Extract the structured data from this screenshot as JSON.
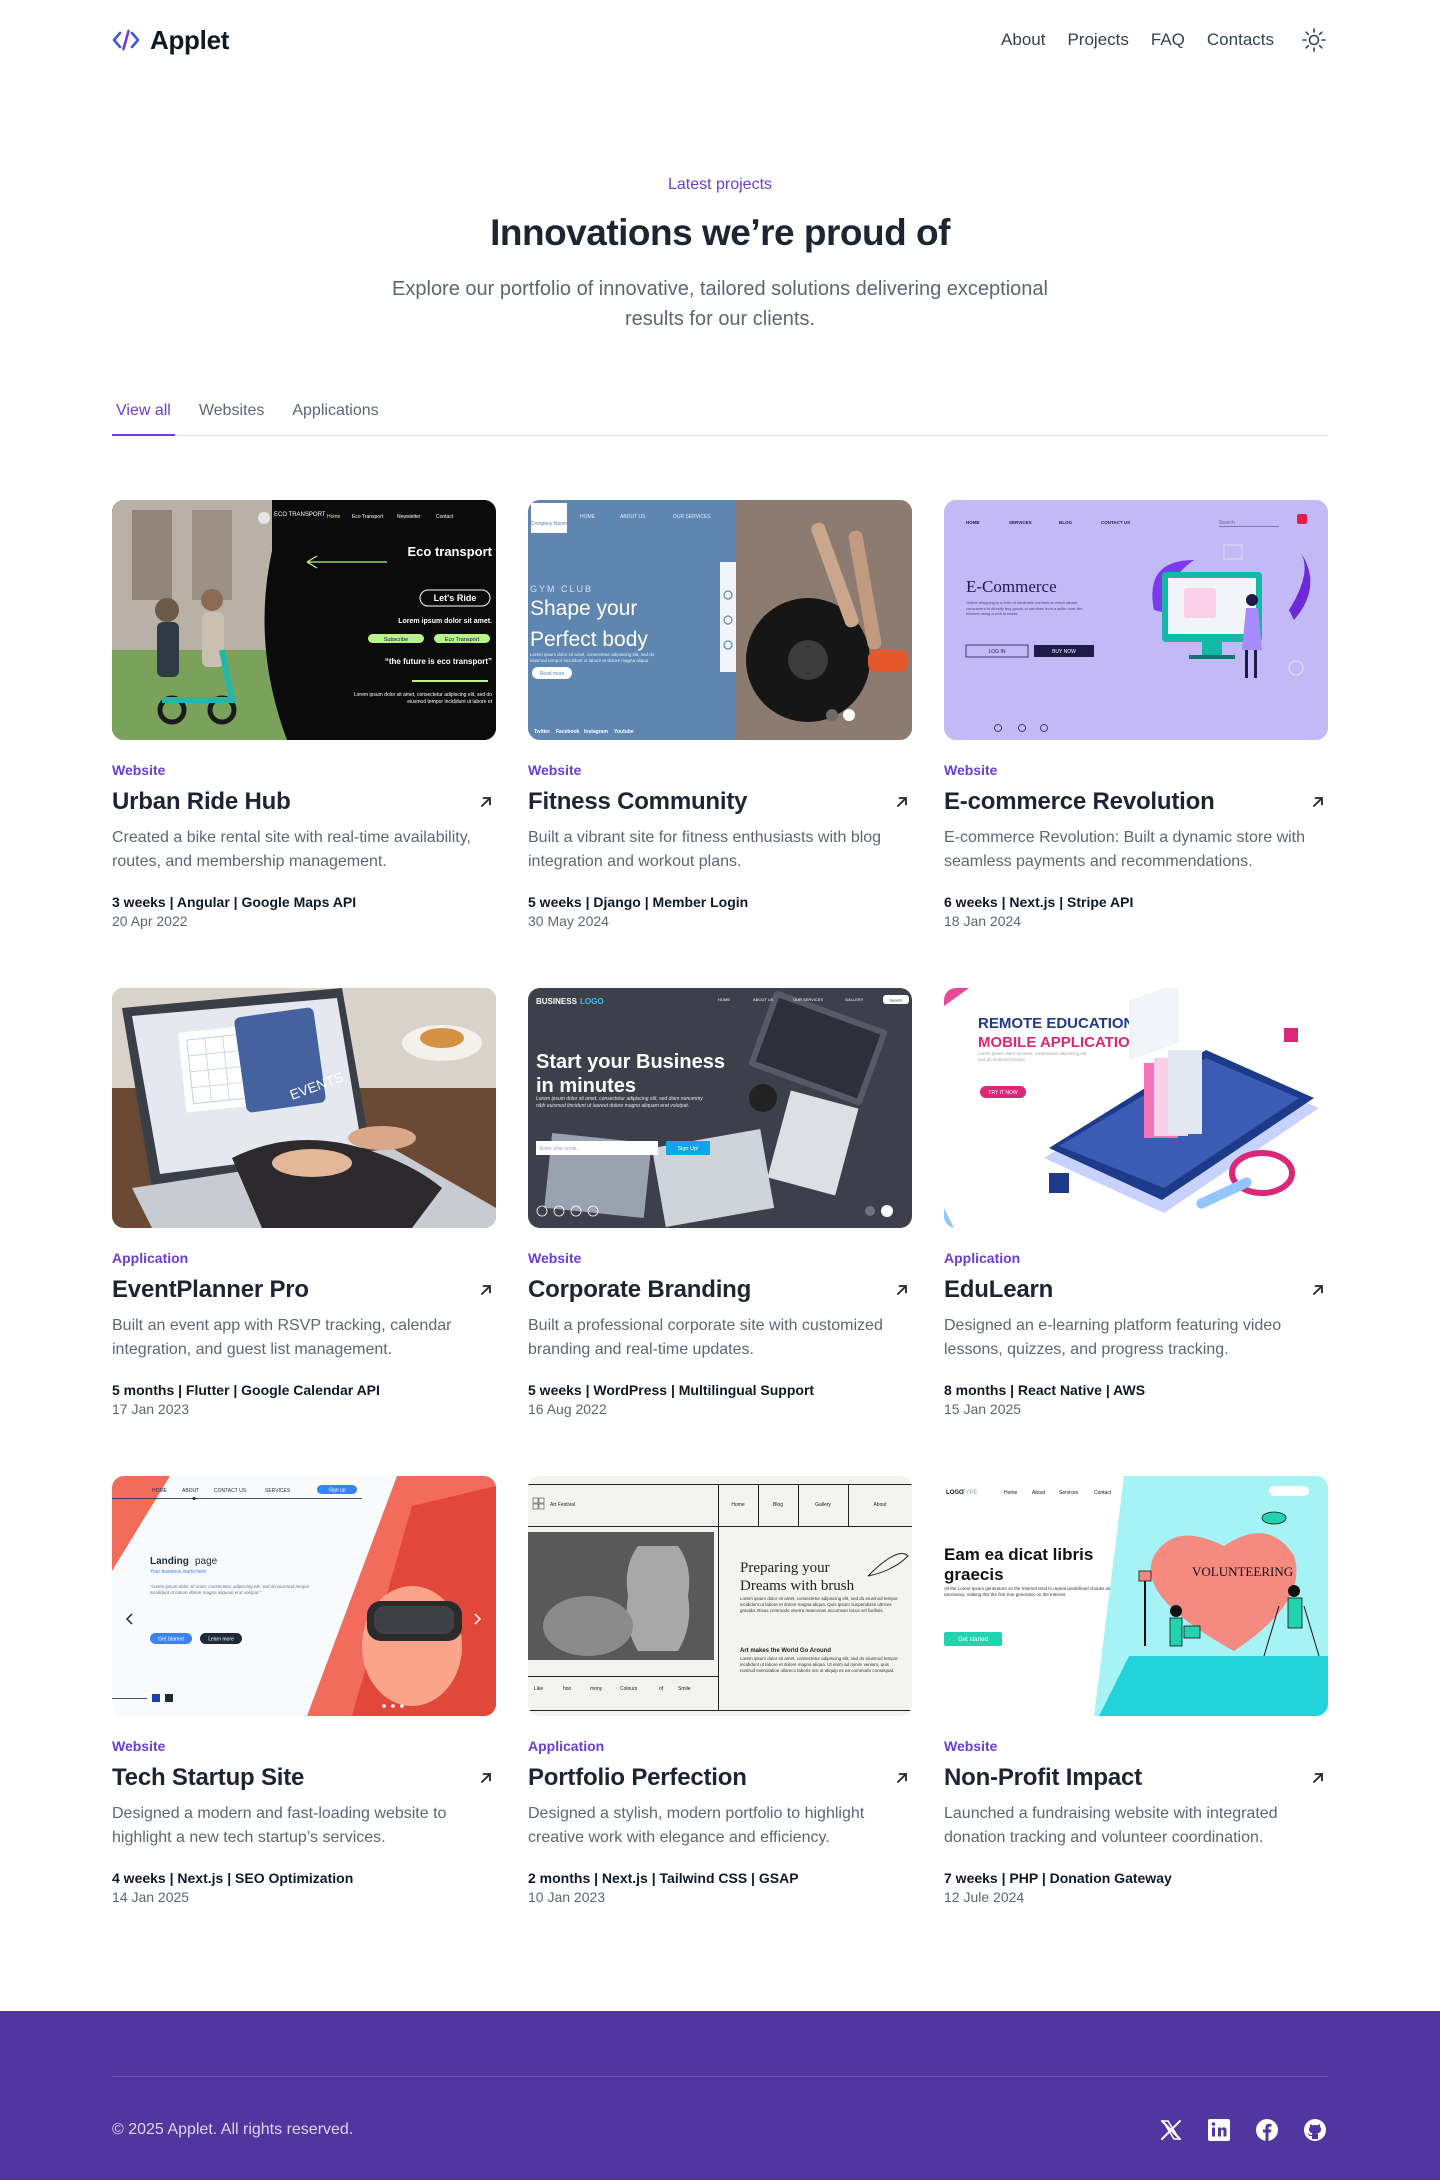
{
  "brand": {
    "name": "Applet",
    "icon": "code-brackets-icon",
    "accent": "#6d3ed6"
  },
  "nav": {
    "items": [
      "About",
      "Projects",
      "FAQ",
      "Contacts"
    ],
    "theme_icon": "sun-icon"
  },
  "hero": {
    "eyebrow": "Latest projects",
    "title": "Innovations we’re proud of",
    "subtitle": "Explore our portfolio of innovative, tailored solutions delivering exceptional results for our clients."
  },
  "tabs": {
    "items": [
      "View all",
      "Websites",
      "Applications"
    ],
    "active": "View all"
  },
  "projects": [
    {
      "category": "Website",
      "title": "Urban Ride Hub",
      "description": "Created a bike rental site with real-time availability, routes, and membership management.",
      "meta": "3 weeks | Angular | Google Maps API",
      "date": "20 Apr 2022",
      "thumb": {
        "brand": "ECO TRANSPORT",
        "headline": "Eco transport",
        "cta": "Let's Ride",
        "line": "Lorem ipsum dolor sit amet.",
        "btn1": "Subscribe",
        "btn2": "Eco Transport",
        "quote": "“the future is eco transport”",
        "small": "Lorem ipsum dolor sit amet, consectetur adipiscing elit, sed do eiusmod tempor incididunt ut labore et",
        "menu": [
          "Home",
          "Eco Transport",
          "Newsletter",
          "Contact"
        ]
      }
    },
    {
      "category": "Website",
      "title": "Fitness Community",
      "description": "Built a vibrant site for fitness enthusiasts with blog integration and workout plans.",
      "meta": "5 weeks | Django | Member Login",
      "date": "30 May 2024",
      "thumb": {
        "kicker": "GYM CLUB",
        "headline1": "Shape your",
        "headline2": "Perfect body",
        "small": "Lorem ipsum dolor sit amet, consectetur adipiscing elit, sed do eiusmod tempor incididunt ut labore et dolore magna aliqua",
        "btn": "Read more",
        "brand": "Company Name",
        "menu": [
          "HOME",
          "ABOUT US",
          "OUR SERVICES"
        ],
        "socials": [
          "Twitter",
          "Facebook",
          "Instagram",
          "Youtube"
        ]
      }
    },
    {
      "category": "Website",
      "title": "E-commerce Revolution",
      "description": "E-commerce Revolution: Built a dynamic store with seamless payments and recommendations.",
      "meta": "6 weeks | Next.js | Stripe API",
      "date": "18 Jan 2024",
      "thumb": {
        "headline": "E-Commerce",
        "small": "Online shopping is a form of electronic commerce which allows consumers to directly buy goods or services from a seller over the Internet using a web browser.",
        "btn1": "LOG IN",
        "btn2": "BUY NOW",
        "menu": [
          "HOME",
          "SERVICES",
          "BLOG",
          "CONTACT US"
        ],
        "search": "Search"
      }
    },
    {
      "category": "Application",
      "title": "EventPlanner Pro",
      "description": "Built an event app with RSVP tracking, calendar integration, and guest list management.",
      "meta": "5 months | Flutter | Google Calendar API",
      "date": "17 Jan 2023",
      "thumb": {
        "label": "EVENTS"
      }
    },
    {
      "category": "Website",
      "title": "Corporate Branding",
      "description": "Built a professional corporate site with customized branding and real-time updates.",
      "meta": "5 weeks | WordPress | Multilingual Support",
      "date": "16 Aug 2022",
      "thumb": {
        "brand1": "BUSINESS",
        "brand2": "LOGO",
        "headline1": "Start your Business",
        "headline2": "in minutes",
        "small": "Lorem ipsum dolor sit amet, consectetur adipiscing elit, sed diam nonummy nibh euismod tincidunt ut laoreet dolore magna aliquam erat volutpat.",
        "input": "Enter your email...",
        "btn": "Sign Up!",
        "menu": [
          "HOME",
          "ABOUT US",
          "OUR SERVICES",
          "GALLERY"
        ],
        "search": "Search"
      }
    },
    {
      "category": "Application",
      "title": "EduLearn",
      "description": "Designed an e-learning platform featuring video lessons, quizzes, and progress tracking.",
      "meta": "8 months | React Native | AWS",
      "date": "15 Jan 2025",
      "thumb": {
        "headline1": "REMOTE EDUCATION",
        "headline2": "MOBILE APPLICATION",
        "small": "Lorem ipsum dolor sit amet, consectetur adipiscing elit, sed do eiusmod tempor",
        "btn": "TRY IT NOW"
      }
    },
    {
      "category": "Website",
      "title": "Tech Startup Site",
      "description": "Designed a modern and fast-loading website to highlight a new tech startup’s services.",
      "meta": "4 weeks | Next.js | SEO Optimization",
      "date": "14 Jan 2025",
      "thumb": {
        "headline1": "Landing",
        "headline2": "page",
        "tagline": "Your business starts here",
        "small": "“Lorem ipsum dolor sit amet, consectetur adipiscing elit, sed do eiusmod tempor incididunt ut labore dolore magna aliquam erat volupat.”",
        "btn1": "Get Started",
        "btn2": "Learn more",
        "menu": [
          "HOME",
          "ABOUT",
          "CONTACT US",
          "SERVICES"
        ],
        "signup": "Sign up"
      }
    },
    {
      "category": "Application",
      "title": "Portfolio Perfection",
      "description": "Designed a stylish, modern portfolio to highlight creative work with elegance and efficiency.",
      "meta": "2 months | Next.js | Tailwind CSS | GSAP",
      "date": "10 Jan 2023",
      "thumb": {
        "brand": "Art Festival",
        "menu": [
          "Home",
          "Blog",
          "Gallery",
          "About"
        ],
        "headline1": "Preparing your",
        "headline2": "Dreams with brush",
        "small": "Lorem ipsum dolor sit amet, consectetur adipiscing elit, sed do eiusmod tempor incididunt ut labore et dolore magna aliqua. Quis ipsum suspendisse ultrices gravida. Risus commodo viverra maecenas accumsan lacus vel facilisis.",
        "sub": "Art makes the World Go Around",
        "small2": "Lorem ipsum dolor sit amet, consectetur adipiscing elit, sed do eiusmod tempor incididunt ut labore et dolore magna aliqua. Ut enim ad minim veniam, quis nostrud exercitation ullamco laboris nisi ut aliquip ex ea commodo consequat.",
        "words": [
          "Like",
          "hoo",
          "mony",
          "Colours",
          "of",
          "Smile"
        ]
      }
    },
    {
      "category": "Website",
      "title": "Non-Profit Impact",
      "description": "Launched a fundraising website with integrated donation tracking and volunteer coordination.",
      "meta": "7 weeks | PHP | Donation Gateway",
      "date": "12 Jule 2024",
      "thumb": {
        "logo1": "LOGO",
        "logo2": "TYPE",
        "menu": [
          "Home",
          "About",
          "Services",
          "Contact"
        ],
        "headline1": "Eam ea dicat libris",
        "headline2": "graecis",
        "small": "All the Lorem Ipsum generators on the Internet tend to repeat predefined chunks as necessary, making this the first true generator on the Internet.",
        "btn": "Get started",
        "label": "VOLUNTEERING"
      }
    }
  ],
  "footer": {
    "copyright": "© 2025 Applet. All rights reserved.",
    "socials": [
      "x-icon",
      "linkedin-icon",
      "facebook-icon",
      "github-icon"
    ],
    "background": "#5236a0"
  }
}
